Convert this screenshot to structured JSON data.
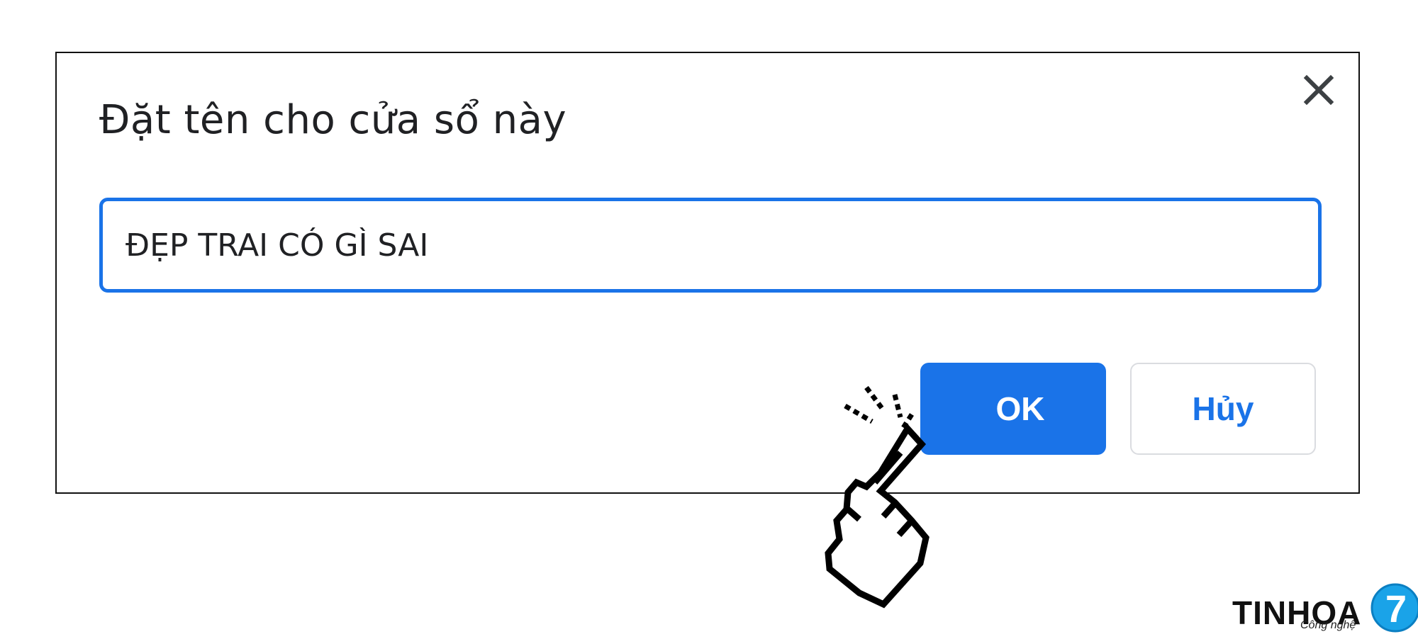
{
  "dialog": {
    "title": "Đặt tên cho cửa sổ này",
    "close_icon": "close-icon",
    "input_value": "ĐẸP TRAI CÓ GÌ SAI",
    "ok_label": "OK",
    "cancel_label": "Hủy"
  },
  "logo": {
    "brand": "TINHOA",
    "tagline": "Công nghệ",
    "badge": "7"
  },
  "colors": {
    "accent": "#1a73e8",
    "text": "#202124",
    "border": "#111111"
  },
  "cursor_icon": "hand-pointer-icon"
}
